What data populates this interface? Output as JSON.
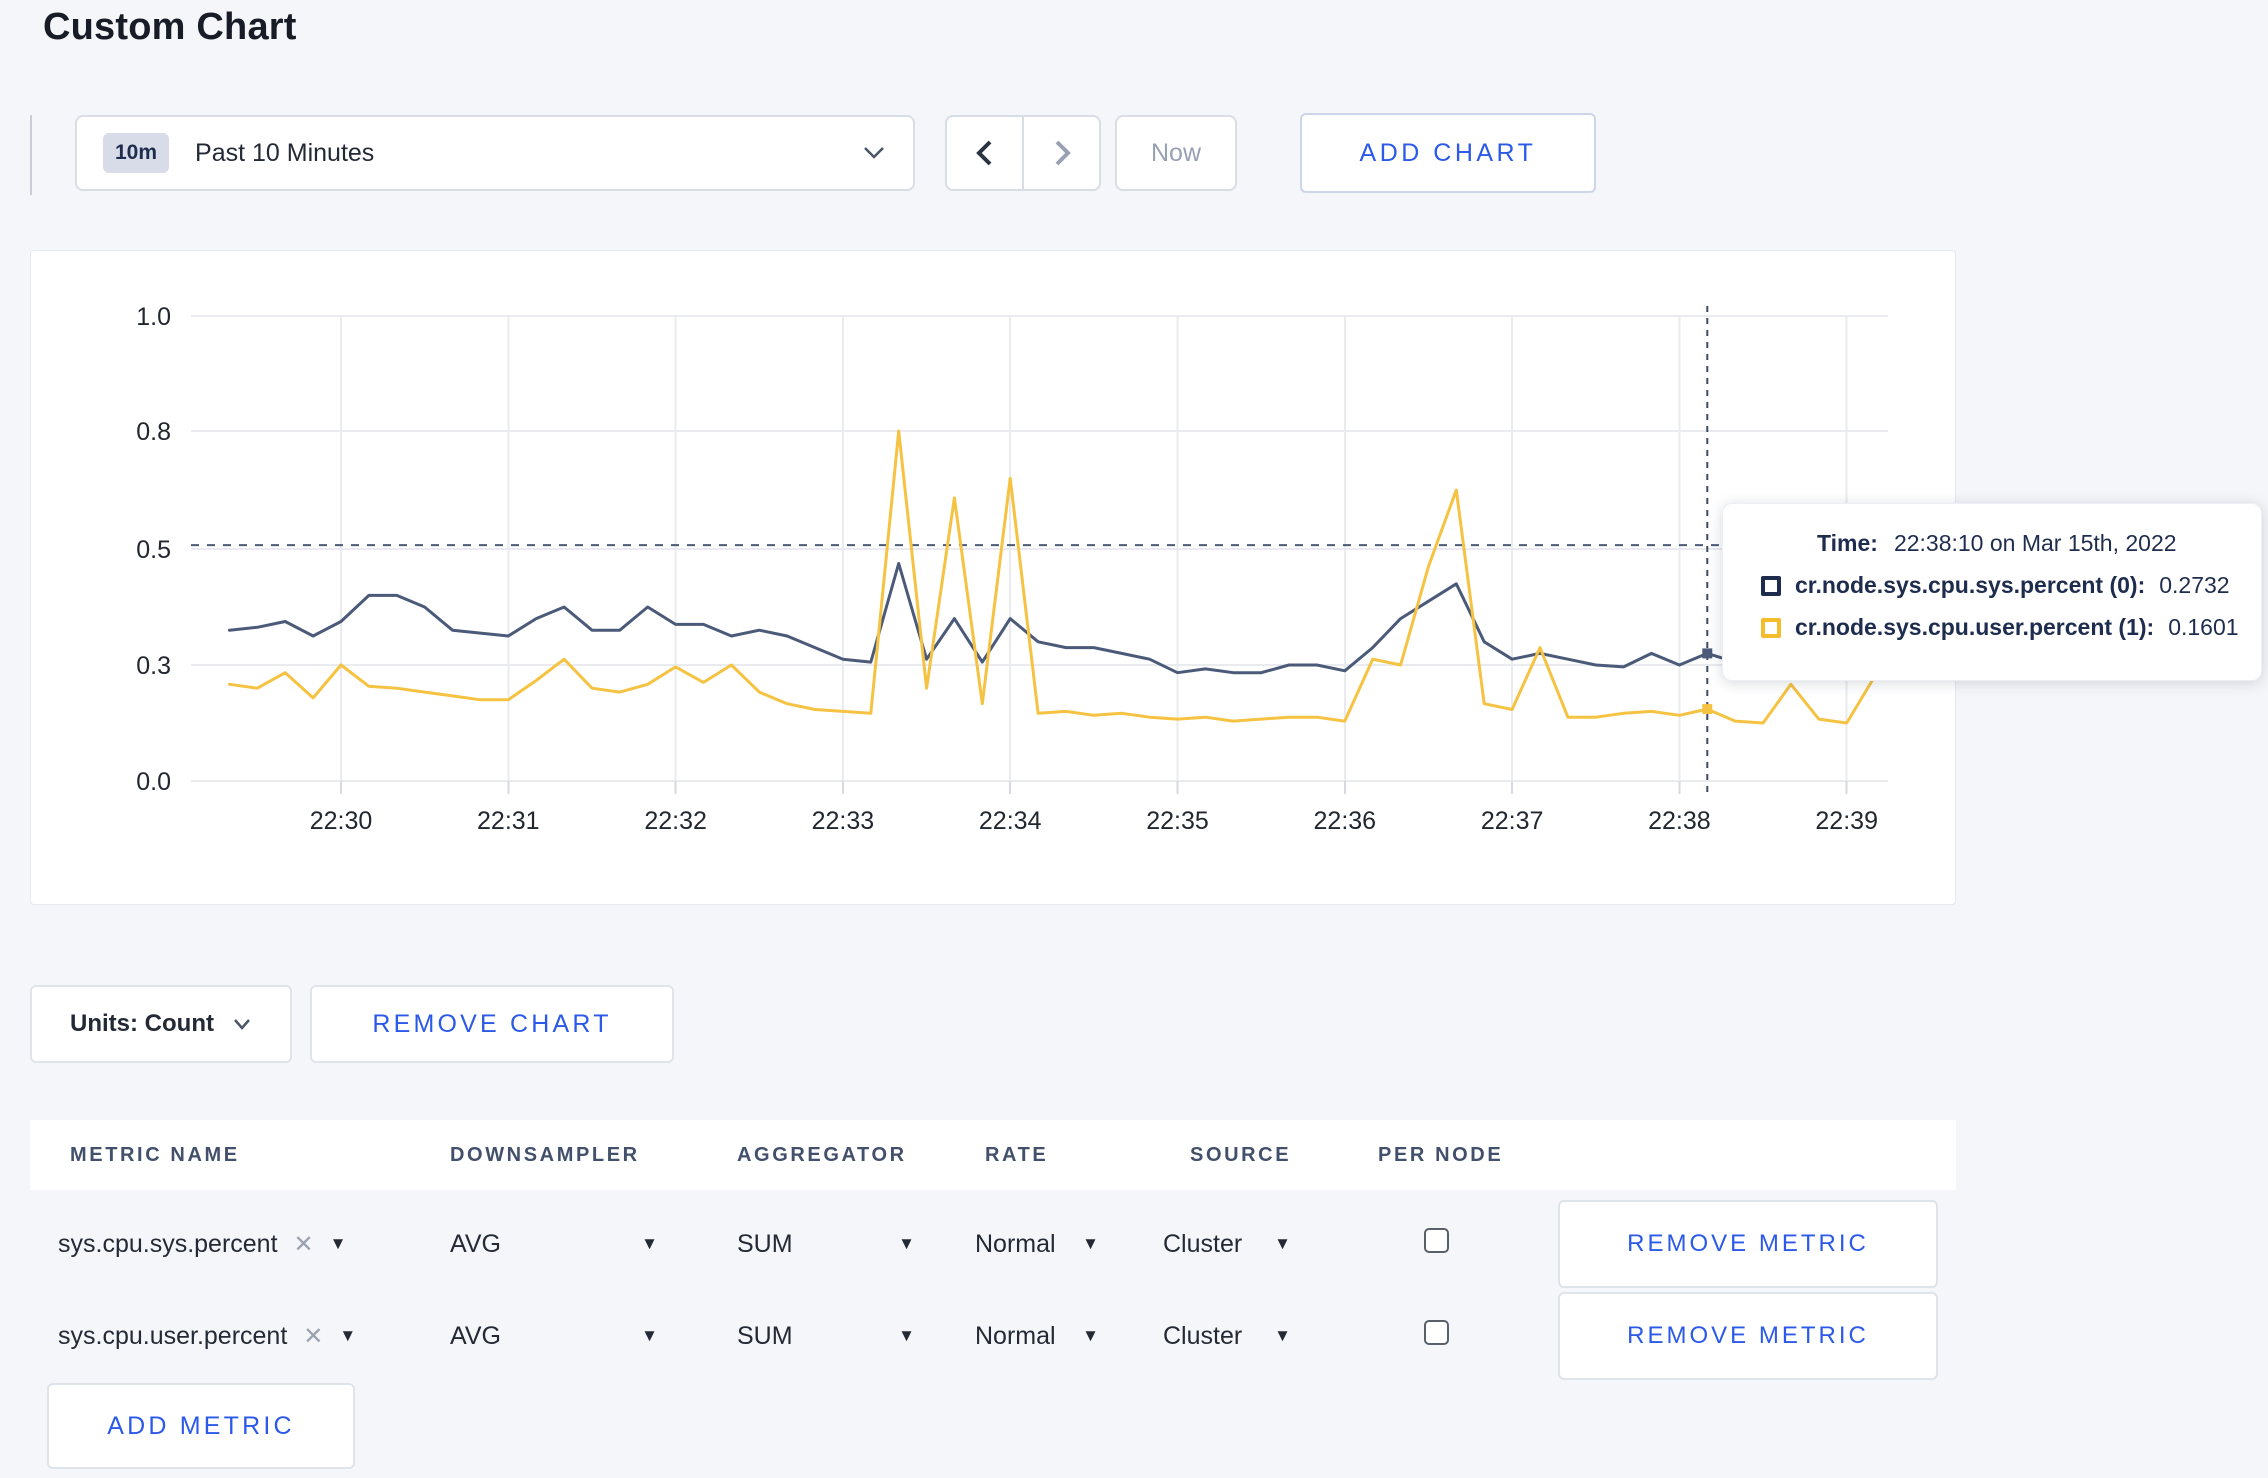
{
  "page": {
    "title": "Custom Chart"
  },
  "toolbar": {
    "time_badge": "10m",
    "time_label": "Past 10 Minutes",
    "now_label": "Now",
    "add_chart_label": "ADD CHART"
  },
  "chart_controls": {
    "units_label": "Units: Count",
    "remove_chart_label": "REMOVE CHART"
  },
  "tooltip": {
    "time_label": "Time:",
    "time_value": "22:38:10 on Mar 15th, 2022",
    "series": [
      {
        "label": "cr.node.sys.cpu.sys.percent (0):",
        "value": "0.2732",
        "color": "#1e2c4e"
      },
      {
        "label": "cr.node.sys.cpu.user.percent (1):",
        "value": "0.1601",
        "color": "#f5bd2b"
      }
    ]
  },
  "metrics_table": {
    "headers": [
      "METRIC NAME",
      "DOWNSAMPLER",
      "AGGREGATOR",
      "RATE",
      "SOURCE",
      "PER NODE"
    ],
    "rows": [
      {
        "metric": "sys.cpu.sys.percent",
        "downsampler": "AVG",
        "aggregator": "SUM",
        "rate": "Normal",
        "source": "Cluster",
        "per_node_checked": false,
        "remove_label": "REMOVE METRIC"
      },
      {
        "metric": "sys.cpu.user.percent",
        "downsampler": "AVG",
        "aggregator": "SUM",
        "rate": "Normal",
        "source": "Cluster",
        "per_node_checked": false,
        "remove_label": "REMOVE METRIC"
      }
    ],
    "add_metric_label": "ADD METRIC"
  },
  "chart_data": {
    "type": "line",
    "title": "",
    "xlabel": "",
    "ylabel": "",
    "grid": true,
    "x_tick_labels": [
      "22:30",
      "22:31",
      "22:32",
      "22:33",
      "22:34",
      "22:35",
      "22:36",
      "22:37",
      "22:38",
      "22:39"
    ],
    "y_axis": {
      "tick_values": [
        0.0,
        0.3,
        0.5,
        0.8,
        1.0
      ],
      "tick_labels": [
        "0.0",
        "0.3",
        "0.5",
        "0.8",
        "1.0"
      ]
    },
    "threshold_dashed_value": 0.51,
    "crosshair_time": "22:38:10",
    "series": [
      {
        "name": "cr.node.sys.cpu.sys.percent",
        "color": "#4a5a78",
        "hover_value_shown": "0.2732",
        "points": [
          [
            "22:29:20",
            0.36
          ],
          [
            "22:29:30",
            0.365
          ],
          [
            "22:29:40",
            0.375
          ],
          [
            "22:29:50",
            0.35
          ],
          [
            "22:30:00",
            0.375
          ],
          [
            "22:30:10",
            0.42
          ],
          [
            "22:30:20",
            0.42
          ],
          [
            "22:30:30",
            0.4
          ],
          [
            "22:30:40",
            0.36
          ],
          [
            "22:30:50",
            0.355
          ],
          [
            "22:31:00",
            0.35
          ],
          [
            "22:31:10",
            0.38
          ],
          [
            "22:31:20",
            0.4
          ],
          [
            "22:31:30",
            0.36
          ],
          [
            "22:31:40",
            0.36
          ],
          [
            "22:31:50",
            0.4
          ],
          [
            "22:32:00",
            0.37
          ],
          [
            "22:32:10",
            0.37
          ],
          [
            "22:32:20",
            0.35
          ],
          [
            "22:32:30",
            0.36
          ],
          [
            "22:32:40",
            0.35
          ],
          [
            "22:32:50",
            0.33
          ],
          [
            "22:33:00",
            0.31
          ],
          [
            "22:33:10",
            0.305
          ],
          [
            "22:33:20",
            0.475
          ],
          [
            "22:33:30",
            0.31
          ],
          [
            "22:33:40",
            0.38
          ],
          [
            "22:33:50",
            0.305
          ],
          [
            "22:34:00",
            0.38
          ],
          [
            "22:34:10",
            0.34
          ],
          [
            "22:34:20",
            0.33
          ],
          [
            "22:34:30",
            0.33
          ],
          [
            "22:34:40",
            0.32
          ],
          [
            "22:34:50",
            0.31
          ],
          [
            "22:35:00",
            0.28
          ],
          [
            "22:35:10",
            0.29
          ],
          [
            "22:35:20",
            0.28
          ],
          [
            "22:35:30",
            0.28
          ],
          [
            "22:35:40",
            0.3
          ],
          [
            "22:35:50",
            0.3
          ],
          [
            "22:36:00",
            0.285
          ],
          [
            "22:36:10",
            0.33
          ],
          [
            "22:36:20",
            0.38
          ],
          [
            "22:36:30",
            0.41
          ],
          [
            "22:36:40",
            0.44
          ],
          [
            "22:36:50",
            0.34
          ],
          [
            "22:37:00",
            0.31
          ],
          [
            "22:37:10",
            0.32
          ],
          [
            "22:37:20",
            0.31
          ],
          [
            "22:37:30",
            0.3
          ],
          [
            "22:37:40",
            0.295
          ],
          [
            "22:37:50",
            0.32
          ],
          [
            "22:38:00",
            0.3
          ],
          [
            "22:38:10",
            0.32
          ],
          [
            "22:38:20",
            0.305
          ],
          [
            "22:38:30",
            0.3
          ],
          [
            "22:38:40",
            0.31
          ],
          [
            "22:38:50",
            0.3
          ],
          [
            "22:39:00",
            0.305
          ],
          [
            "22:39:10",
            0.3
          ]
        ]
      },
      {
        "name": "cr.node.sys.cpu.user.percent",
        "color": "#f5c242",
        "hover_value_shown": "0.1601",
        "points": [
          [
            "22:29:20",
            0.25
          ],
          [
            "22:29:30",
            0.24
          ],
          [
            "22:29:40",
            0.28
          ],
          [
            "22:29:50",
            0.215
          ],
          [
            "22:30:00",
            0.3
          ],
          [
            "22:30:10",
            0.245
          ],
          [
            "22:30:20",
            0.24
          ],
          [
            "22:30:30",
            0.23
          ],
          [
            "22:30:40",
            0.22
          ],
          [
            "22:30:50",
            0.21
          ],
          [
            "22:31:00",
            0.21
          ],
          [
            "22:31:10",
            0.26
          ],
          [
            "22:31:20",
            0.31
          ],
          [
            "22:31:30",
            0.24
          ],
          [
            "22:31:40",
            0.23
          ],
          [
            "22:31:50",
            0.25
          ],
          [
            "22:32:00",
            0.295
          ],
          [
            "22:32:10",
            0.255
          ],
          [
            "22:32:20",
            0.3
          ],
          [
            "22:32:30",
            0.23
          ],
          [
            "22:32:40",
            0.2
          ],
          [
            "22:32:50",
            0.185
          ],
          [
            "22:33:00",
            0.18
          ],
          [
            "22:33:10",
            0.175
          ],
          [
            "22:33:20",
            0.8
          ],
          [
            "22:33:30",
            0.24
          ],
          [
            "22:33:40",
            0.63
          ],
          [
            "22:33:50",
            0.2
          ],
          [
            "22:34:00",
            0.68
          ],
          [
            "22:34:10",
            0.175
          ],
          [
            "22:34:20",
            0.18
          ],
          [
            "22:34:30",
            0.17
          ],
          [
            "22:34:40",
            0.175
          ],
          [
            "22:34:50",
            0.165
          ],
          [
            "22:35:00",
            0.16
          ],
          [
            "22:35:10",
            0.165
          ],
          [
            "22:35:20",
            0.155
          ],
          [
            "22:35:30",
            0.16
          ],
          [
            "22:35:40",
            0.165
          ],
          [
            "22:35:50",
            0.165
          ],
          [
            "22:36:00",
            0.155
          ],
          [
            "22:36:10",
            0.31
          ],
          [
            "22:36:20",
            0.3
          ],
          [
            "22:36:30",
            0.47
          ],
          [
            "22:36:40",
            0.65
          ],
          [
            "22:36:50",
            0.2
          ],
          [
            "22:37:00",
            0.185
          ],
          [
            "22:37:10",
            0.33
          ],
          [
            "22:37:20",
            0.165
          ],
          [
            "22:37:30",
            0.165
          ],
          [
            "22:37:40",
            0.175
          ],
          [
            "22:37:50",
            0.18
          ],
          [
            "22:38:00",
            0.17
          ],
          [
            "22:38:10",
            0.186
          ],
          [
            "22:38:20",
            0.155
          ],
          [
            "22:38:30",
            0.15
          ],
          [
            "22:38:40",
            0.25
          ],
          [
            "22:38:50",
            0.16
          ],
          [
            "22:39:00",
            0.15
          ],
          [
            "22:39:10",
            0.27
          ]
        ]
      }
    ]
  }
}
